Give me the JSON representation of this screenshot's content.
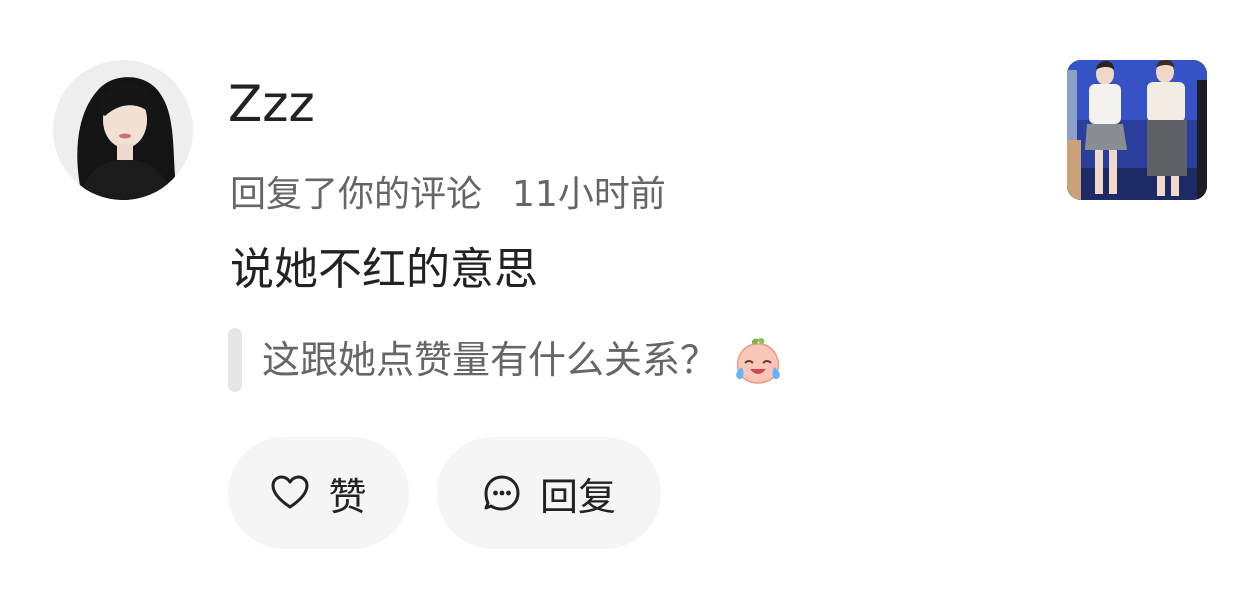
{
  "comment": {
    "username": "Zzz",
    "action_text": "回复了你的评论",
    "time": "11小时前",
    "content": "说她不红的意思",
    "quoted_text": "这跟她点赞量有什么关系？",
    "quoted_emoji": "crying-laughing-peach-emoji"
  },
  "actions": {
    "like_label": "赞",
    "reply_label": "回复"
  },
  "icons": {
    "like": "heart-outline-icon",
    "reply": "chat-bubble-dots-icon"
  },
  "colors": {
    "background": "#ffffff",
    "primary_text": "#222222",
    "secondary_text": "#666666",
    "button_bg": "#f5f5f5",
    "quote_bar": "#e6e6e6"
  }
}
